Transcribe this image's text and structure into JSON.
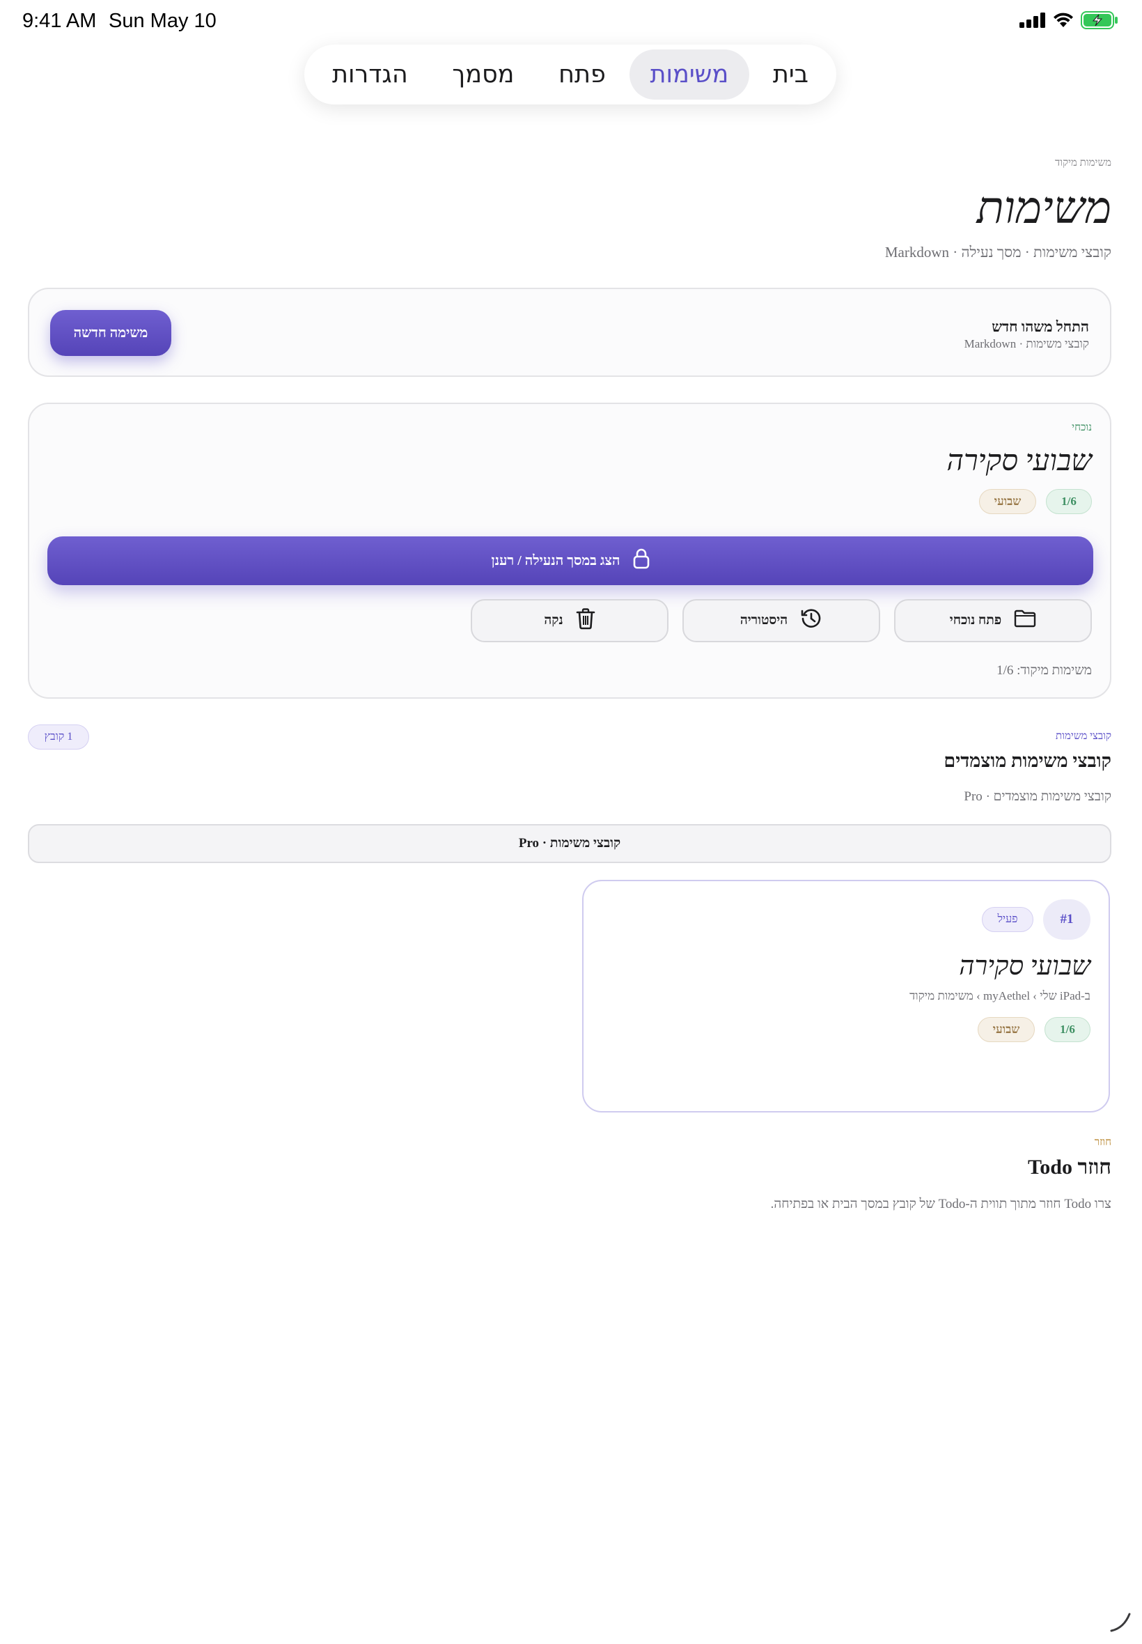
{
  "status_bar": {
    "time": "9:41 AM",
    "date": "Sun May 10"
  },
  "tabs": [
    "בית",
    "משימות",
    "פתח",
    "מסמך",
    "הגדרות"
  ],
  "active_tab": "משימות",
  "header": {
    "eyebrow": "משימות מיקוד",
    "title": "משימות",
    "subtitle": "קובצי משימות · מסך נעילה · Markdown"
  },
  "new_card": {
    "title": "התחל משהו חדש",
    "subtitle": "קובצי משימות · Markdown",
    "button": "משימה חדשה"
  },
  "current_card": {
    "eyebrow": "נוכחי",
    "title": "שבועי סקירה",
    "progress_pill": "1/6",
    "period_pill": "שבועי",
    "lock_button": "הצג במסך הנעילה / רענן",
    "open_button": "פתח נוכחי",
    "history_button": "היסטוריה",
    "clear_button": "נקה",
    "footer": "משימות מיקוד: 1/6"
  },
  "pinned": {
    "eyebrow": "קובצי משימות",
    "title": "קובצי משימות מוצמדים",
    "subtitle": "קובצי משימות מוצמדים · Pro",
    "count_badge": "1 קובץ",
    "pro_bar": "קובצי משימות · Pro",
    "file": {
      "number": "#1",
      "status": "פעיל",
      "title": "שבועי סקירה",
      "path": "ב-iPad שלי › myAethel › משימות מיקוד",
      "progress_pill": "1/6",
      "period_pill": "שבועי"
    }
  },
  "recurring": {
    "eyebrow": "חוזר",
    "title": "חוזר Todo",
    "description": "צרו Todo חוזר מתוך תווית ה-Todo של קובץ במסך הבית או בפתיחה."
  },
  "colors": {
    "accent": "#5a4fc8",
    "green": "#3d8f62",
    "amber": "#b8862f",
    "battery": "#34c759"
  },
  "icons": {
    "lock": "lock-icon",
    "folder": "folder-icon",
    "history": "history-icon",
    "trash": "trash-icon"
  }
}
